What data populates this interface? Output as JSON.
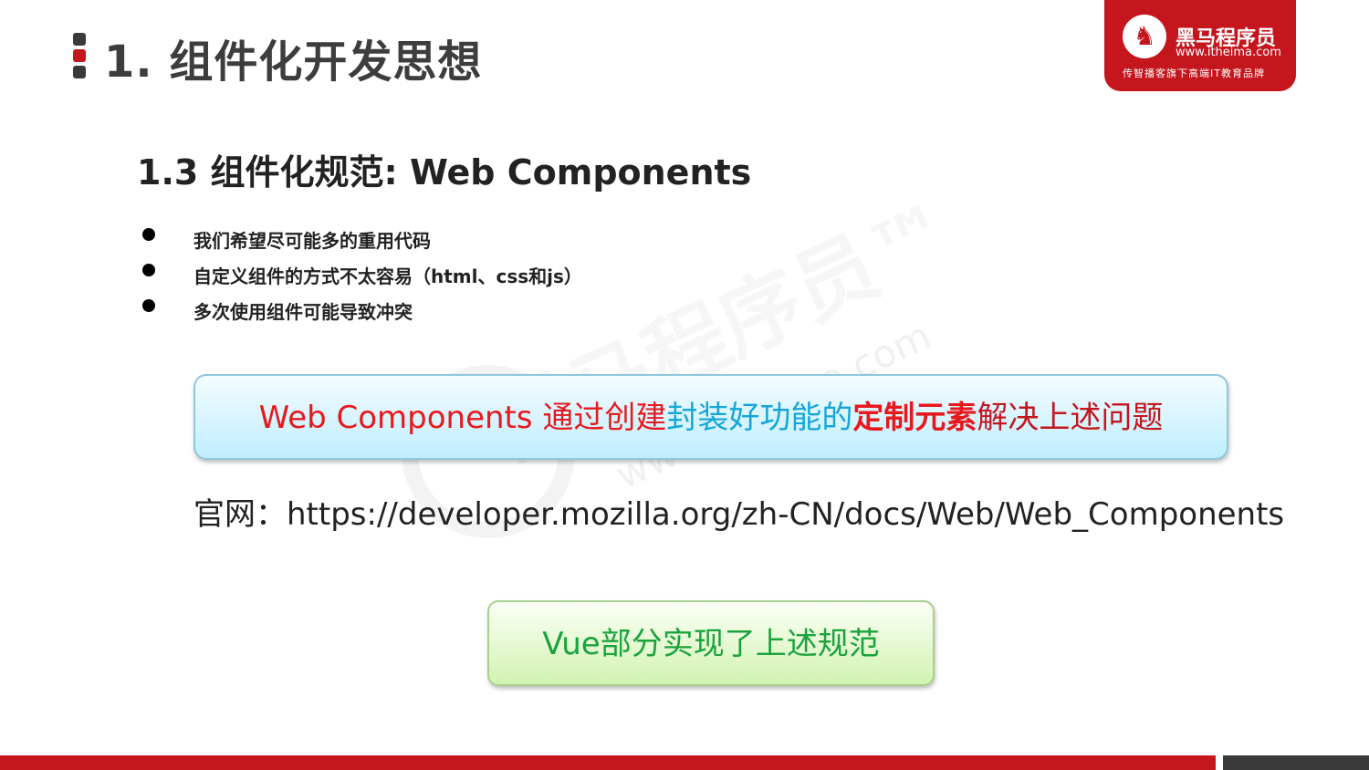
{
  "header": {
    "title": "1. 组件化开发思想"
  },
  "logo": {
    "name": "黑马程序员",
    "url": "www.itheima.com",
    "slogan": "传智播客旗下高端IT教育品牌"
  },
  "watermark": {
    "text": "黑马程序员™",
    "url": "www.itheima.com"
  },
  "section": {
    "subtitle": "1.3 组件化规范: Web Components",
    "bullets": [
      "我们希望尽可能多的重用代码",
      "自定义组件的方式不太容易（html、css和js）",
      "多次使用组件可能导致冲突"
    ]
  },
  "highlight": {
    "part1": "Web Components 通过创建",
    "part2": "封装好功能的",
    "part3": "定制元素",
    "part4": "解决上述问题"
  },
  "official": {
    "label": "官网：",
    "url": "https://developer.mozilla.org/zh-CN/docs/Web/Web_Components"
  },
  "conclusion": {
    "text": "Vue部分实现了上述规范"
  },
  "colors": {
    "brand_red": "#c4161c",
    "text_red": "#e8191d",
    "text_cyan": "#13a6d8",
    "text_green": "#1aa33d",
    "title_gray": "#3d3d3d"
  }
}
